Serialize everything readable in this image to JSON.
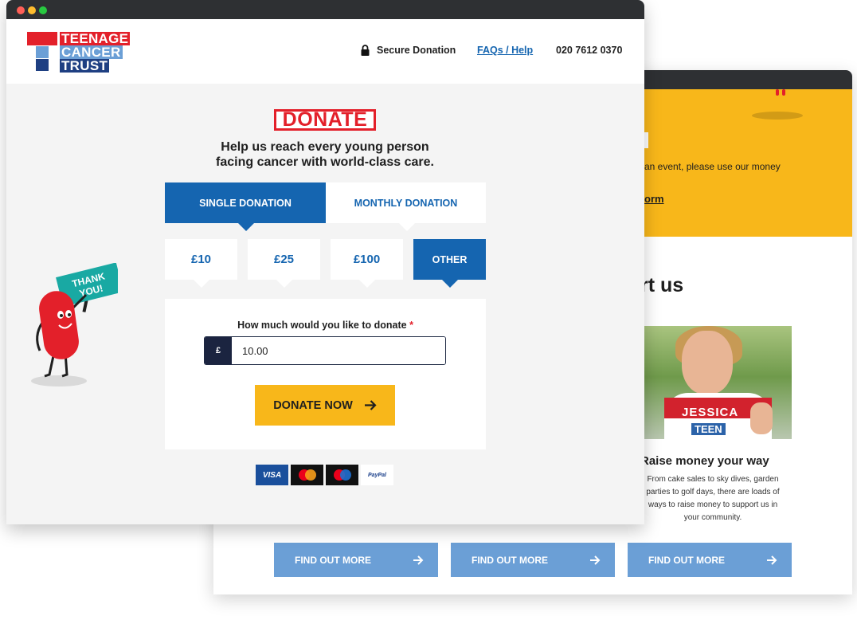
{
  "back_page": {
    "intro_text": "an event, please use our money",
    "intro_link": "orm",
    "heading": "rt us",
    "photo_name": "JESSICA",
    "photo_shirt": "TEEN",
    "card_title": "Raise money your way",
    "card_text": "From cake sales to sky dives, garden parties to golf days, there are loads of ways to raise money to support us in your community.",
    "buttons": [
      {
        "label": "FIND OUT MORE"
      },
      {
        "label": "FIND OUT MORE"
      },
      {
        "label": "FIND OUT MORE"
      }
    ]
  },
  "header": {
    "logo_lines": [
      "TEENAGE",
      "CANCER",
      "TRUST"
    ],
    "secure_label": "Secure Donation",
    "faq_label": "FAQs / Help",
    "phone": "020 7612 0370"
  },
  "main": {
    "title": "DONATE",
    "subtitle_line1": "Help us reach every young person",
    "subtitle_line2": "facing cancer with world-class care."
  },
  "tabs": [
    {
      "label": "SINGLE DONATION",
      "active": true
    },
    {
      "label": "MONTHLY DONATION",
      "active": false
    }
  ],
  "amounts": [
    {
      "label": "£10",
      "selected": false
    },
    {
      "label": "£25",
      "selected": false
    },
    {
      "label": "£100",
      "selected": false
    },
    {
      "label": "OTHER",
      "selected": true
    }
  ],
  "form": {
    "question": "How much would you like to donate",
    "required_marker": "*",
    "currency": "£",
    "amount_value": "10.00",
    "submit_label": "DONATE NOW"
  },
  "payment_methods": [
    {
      "label": "VISA",
      "icon": "visa-icon"
    },
    {
      "label": "mastercard",
      "icon": "mastercard-icon"
    },
    {
      "label": "maestro",
      "icon": "maestro-icon"
    },
    {
      "label": "PayPal",
      "icon": "paypal-icon"
    }
  ],
  "mascot": {
    "sign_line1": "THANK",
    "sign_line2": "YOU!"
  },
  "colors": {
    "brand_red": "#e3202a",
    "brand_blue": "#1565b0",
    "light_blue": "#6b9fd6",
    "navy": "#1e3f82",
    "yellow": "#f8b71a",
    "teal_sign": "#19a9a3"
  }
}
